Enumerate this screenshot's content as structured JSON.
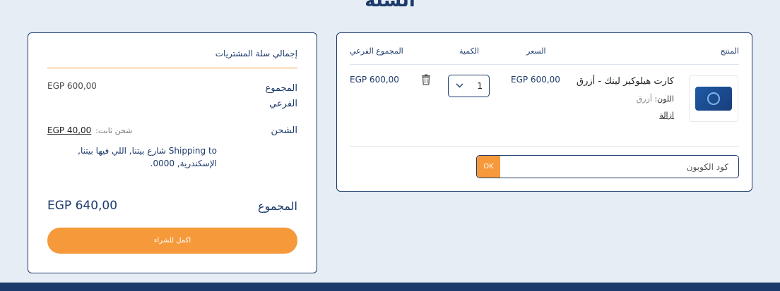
{
  "page": {
    "title": "السلة"
  },
  "cart": {
    "headers": {
      "product": "المنتج",
      "price": "السعر",
      "quantity": "الكمية",
      "subtotal": "المجموع الفرعي"
    },
    "item": {
      "name": "كارت هيلوكير لينك - أزرق",
      "color_label": "اللون:",
      "color_value": "أزرق",
      "remove_label": "ازالة",
      "price": "EGP 600,00",
      "quantity": "1",
      "subtotal": "EGP 600,00"
    },
    "coupon": {
      "placeholder": "كود الكوبون",
      "apply_label": "OK"
    }
  },
  "totals": {
    "title": "إجمالي سلة المشتريات",
    "subtotal_label": "المجموع الفرعي",
    "subtotal_value": "EGP 600,00",
    "shipping_label": "الشحن",
    "shipping_method": "شحن ثابت:",
    "shipping_amount": "EGP 40,00",
    "shipping_to": "Shipping to شارع بيتنا, اللي فيها بيتنا, الإسكندرية, 0000.",
    "total_label": "المجموع",
    "total_value": "EGP 640,00",
    "checkout_label": "اكمل للشراء"
  },
  "icons": {
    "trash": "trash-icon",
    "chevron": "chevron-down-icon"
  },
  "colors": {
    "accent": "#f6993a",
    "primary": "#1c3a6b",
    "background": "#e6edf5"
  }
}
